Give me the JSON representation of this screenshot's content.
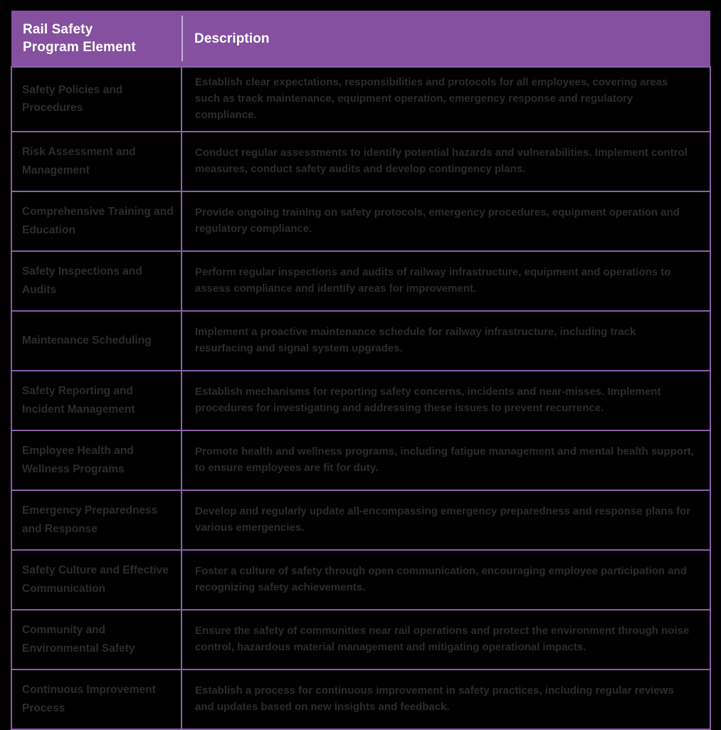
{
  "table": {
    "title": "Rail Safety Program Elements",
    "colors": {
      "header_background": "#85509F",
      "header_text": "#FFFFFF",
      "grid_line": "#8C5FAB",
      "page_background": "#000000",
      "body_text": "#2B2B31"
    },
    "columns": [
      {
        "key": "element",
        "label": "Rail Safety\nProgram Element",
        "label_line1": "Rail Safety",
        "label_line2": "Program Element"
      },
      {
        "key": "description",
        "label": "Description"
      }
    ],
    "rows": [
      {
        "element": "Safety Policies and Procedures",
        "description": "Establish clear expectations, responsibilities and protocols for all employees, covering areas such as track maintenance, equipment operation, emergency response and regulatory compliance."
      },
      {
        "element": "Risk Assessment and Management",
        "description": "Conduct regular assessments to identify potential hazards and vulnerabilities. Implement control measures, conduct safety audits and develop contingency plans."
      },
      {
        "element": "Comprehensive Training and Education",
        "description": "Provide ongoing training on safety protocols, emergency procedures, equipment operation and regulatory compliance."
      },
      {
        "element": "Safety Inspections and Audits",
        "description": "Perform regular inspections and audits of railway infrastructure, equipment and operations to assess compliance and identify areas for improvement."
      },
      {
        "element": "Maintenance Scheduling",
        "description": "Implement a proactive maintenance schedule for railway infrastructure, including track resurfacing and signal system upgrades."
      },
      {
        "element": "Safety Reporting and Incident Management",
        "description": "Establish mechanisms for reporting safety concerns, incidents and near-misses. Implement procedures for investigating and addressing these issues to prevent recurrence."
      },
      {
        "element": "Employee Health and Wellness Programs",
        "description": "Promote health and wellness programs, including fatigue management and mental health support, to ensure employees are fit for duty."
      },
      {
        "element": "Emergency Preparedness and Response",
        "description": "Develop and regularly update all-encompassing emergency preparedness and response plans for various emergencies."
      },
      {
        "element": "Safety Culture and Effective Communication",
        "description": "Foster a culture of safety through open communication, encouraging employee participation and recognizing safety achievements."
      },
      {
        "element": "Community and Environmental Safety",
        "description": "Ensure the safety of communities near rail operations and protect the environment through noise control, hazardous material management and mitigating operational impacts."
      },
      {
        "element": "Continuous Improvement Process",
        "description": "Establish a process for continuous improvement in safety practices, including regular reviews and updates based on new insights and feedback."
      }
    ]
  }
}
